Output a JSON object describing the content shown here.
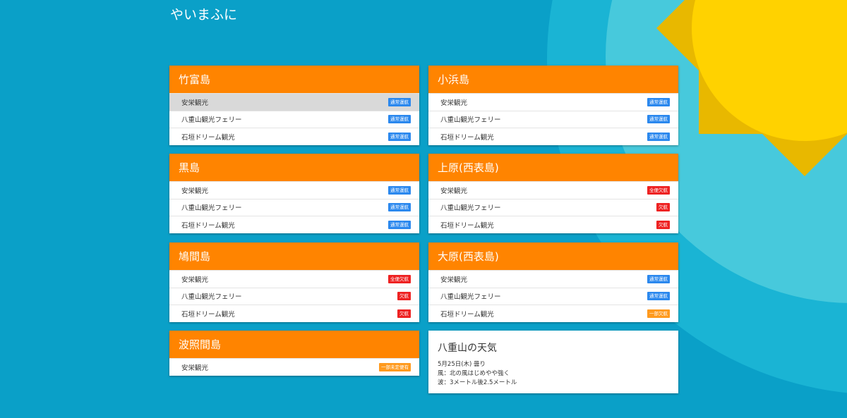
{
  "app": {
    "title": "やいまふに"
  },
  "status_colors": {
    "normal": "#2b88ee",
    "cancel": "#ee2222",
    "partial": "#ff9a1e",
    "header": "#ff8400"
  },
  "islands": [
    {
      "name": "竹富島",
      "routes": [
        {
          "company": "安栄観光",
          "status": "通常運航",
          "type": "normal"
        },
        {
          "company": "八重山観光フェリー",
          "status": "通常運航",
          "type": "normal"
        },
        {
          "company": "石垣ドリーム観光",
          "status": "通常運航",
          "type": "normal"
        }
      ]
    },
    {
      "name": "小浜島",
      "routes": [
        {
          "company": "安栄観光",
          "status": "通常運航",
          "type": "normal"
        },
        {
          "company": "八重山観光フェリー",
          "status": "通常運航",
          "type": "normal"
        },
        {
          "company": "石垣ドリーム観光",
          "status": "通常運航",
          "type": "normal"
        }
      ]
    },
    {
      "name": "黒島",
      "routes": [
        {
          "company": "安栄観光",
          "status": "通常運航",
          "type": "normal"
        },
        {
          "company": "八重山観光フェリー",
          "status": "通常運航",
          "type": "normal"
        },
        {
          "company": "石垣ドリーム観光",
          "status": "通常運航",
          "type": "normal"
        }
      ]
    },
    {
      "name": "上原(西表島)",
      "routes": [
        {
          "company": "安栄観光",
          "status": "全便欠航",
          "type": "cancel"
        },
        {
          "company": "八重山観光フェリー",
          "status": "欠航",
          "type": "cancel"
        },
        {
          "company": "石垣ドリーム観光",
          "status": "欠航",
          "type": "cancel"
        }
      ]
    },
    {
      "name": "鳩間島",
      "routes": [
        {
          "company": "安栄観光",
          "status": "全便欠航",
          "type": "cancel"
        },
        {
          "company": "八重山観光フェリー",
          "status": "欠航",
          "type": "cancel"
        },
        {
          "company": "石垣ドリーム観光",
          "status": "欠航",
          "type": "cancel"
        }
      ]
    },
    {
      "name": "大原(西表島)",
      "routes": [
        {
          "company": "安栄観光",
          "status": "通常運航",
          "type": "normal"
        },
        {
          "company": "八重山観光フェリー",
          "status": "通常運航",
          "type": "normal"
        },
        {
          "company": "石垣ドリーム観光",
          "status": "一部欠航",
          "type": "partial"
        }
      ]
    },
    {
      "name": "波照間島",
      "routes": [
        {
          "company": "安栄観光",
          "status": "一部未定便有",
          "type": "partial"
        }
      ]
    }
  ],
  "weather": {
    "title": "八重山の天気",
    "date_line": "5月25日(木) 曇り",
    "wind_line": "風：北の風はじめやや強く",
    "wave_line": "波：3メートル後2.5メートル"
  }
}
